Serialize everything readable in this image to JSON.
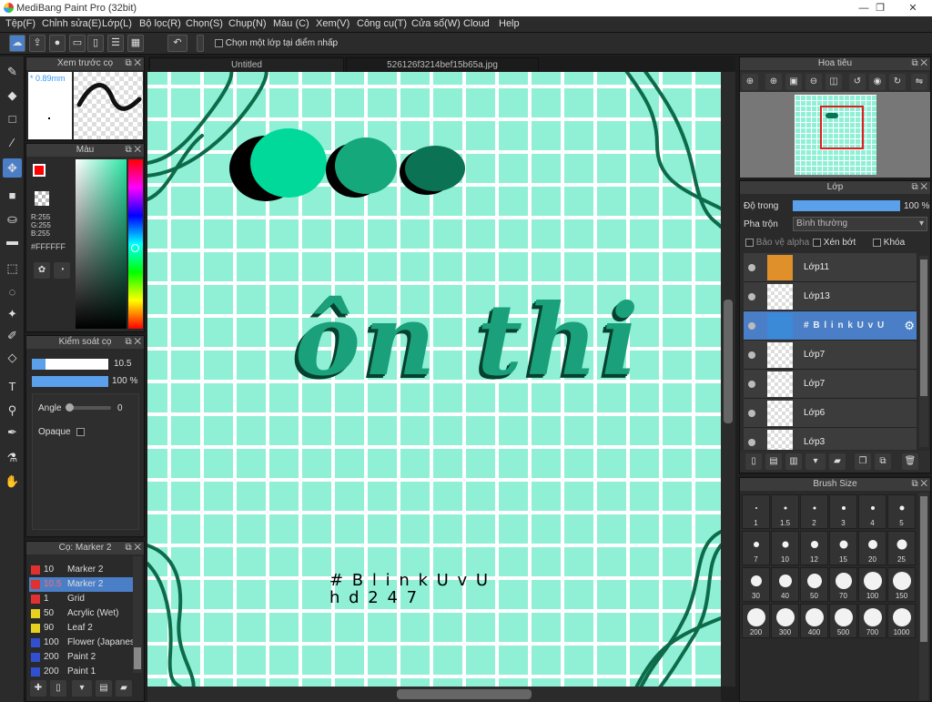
{
  "window": {
    "title": "MediBang Paint Pro (32bit)",
    "min": "—",
    "restore": "❐",
    "close": "✕"
  },
  "menu": [
    "Tệp(F)",
    "Chỉnh sửa(E)",
    "Lớp(L)",
    "Bộ lọc(R)",
    "Chọn(S)",
    "Chụp(N)",
    "Màu (C)",
    "Xem(V)",
    "Công cụ(T)",
    "Cửa sổ(W)",
    "Cloud",
    "Help"
  ],
  "toolbar": {
    "select_layer_label": "Chọn một lớp tại điểm nhấp",
    "undo_icon": "↶"
  },
  "preview": {
    "title": "Xem trước cọ",
    "size": "* 0.89mm"
  },
  "color": {
    "title": "Màu",
    "r": "R:255",
    "g": "G:255",
    "b": "B:255",
    "hex": "#FFFFFF",
    "fg": "#ff0000",
    "bg": "#3dd13d"
  },
  "brush_control": {
    "title": "Kiểm soát cọ",
    "size_value": "10.5",
    "opacity_value": "100 %",
    "angle_label": "Angle",
    "angle_value": "0",
    "opaque_label": "Opaque",
    "opacity_level": 1.0
  },
  "brush_list": {
    "title": "Cọ: Marker 2",
    "items": [
      {
        "num": "10",
        "name": "Marker 2",
        "color": "#e03030",
        "selected": false
      },
      {
        "num": "10.5",
        "name": "Marker 2",
        "color": "#e03030",
        "selected": true
      },
      {
        "num": "1",
        "name": "Grid",
        "color": "#e03030",
        "selected": false
      },
      {
        "num": "50",
        "name": "Acrylic (Wet)",
        "color": "#e6d21e",
        "selected": false
      },
      {
        "num": "90",
        "name": "Leaf 2",
        "color": "#e6d21e",
        "selected": false
      },
      {
        "num": "100",
        "name": "Flower (Japanese",
        "color": "#3050d0",
        "selected": false
      },
      {
        "num": "200",
        "name": "Paint 2",
        "color": "#3050d0",
        "selected": false
      },
      {
        "num": "200",
        "name": "Paint 1",
        "color": "#3050d0",
        "selected": false
      }
    ]
  },
  "tabs": [
    "Untitled",
    "526126f3214bef15b65a.jpg"
  ],
  "artwork": {
    "main_text": "ôn thi",
    "hashtag": "# B l i n k U v U",
    "handle": "h d 2 4 7"
  },
  "navigator": {
    "title": "Hoa tiêu"
  },
  "layers": {
    "title": "Lớp",
    "opacity_label": "Độ trong",
    "opacity_value": "100 %",
    "opacity_level": 1.0,
    "blend_label": "Pha trộn",
    "blend_value": "Bình thường",
    "protect_alpha": "Bảo vệ alpha",
    "clipping": "Xén bớt",
    "lock": "Khóa",
    "items": [
      {
        "name": "Lớp11",
        "selected": false
      },
      {
        "name": "Lớp13",
        "selected": false
      },
      {
        "name": "# B l i n k U v U",
        "selected": true
      },
      {
        "name": "Lớp7",
        "selected": false
      },
      {
        "name": "Lớp7",
        "selected": false
      },
      {
        "name": "Lớp6",
        "selected": false
      },
      {
        "name": "Lớp3",
        "selected": false
      }
    ]
  },
  "brush_size": {
    "title": "Brush Size",
    "sizes": [
      "1",
      "1.5",
      "2",
      "3",
      "4",
      "5",
      "7",
      "10",
      "12",
      "15",
      "20",
      "25",
      "30",
      "40",
      "50",
      "70",
      "100",
      "150",
      "200",
      "300",
      "400",
      "500",
      "700",
      "1000"
    ]
  }
}
